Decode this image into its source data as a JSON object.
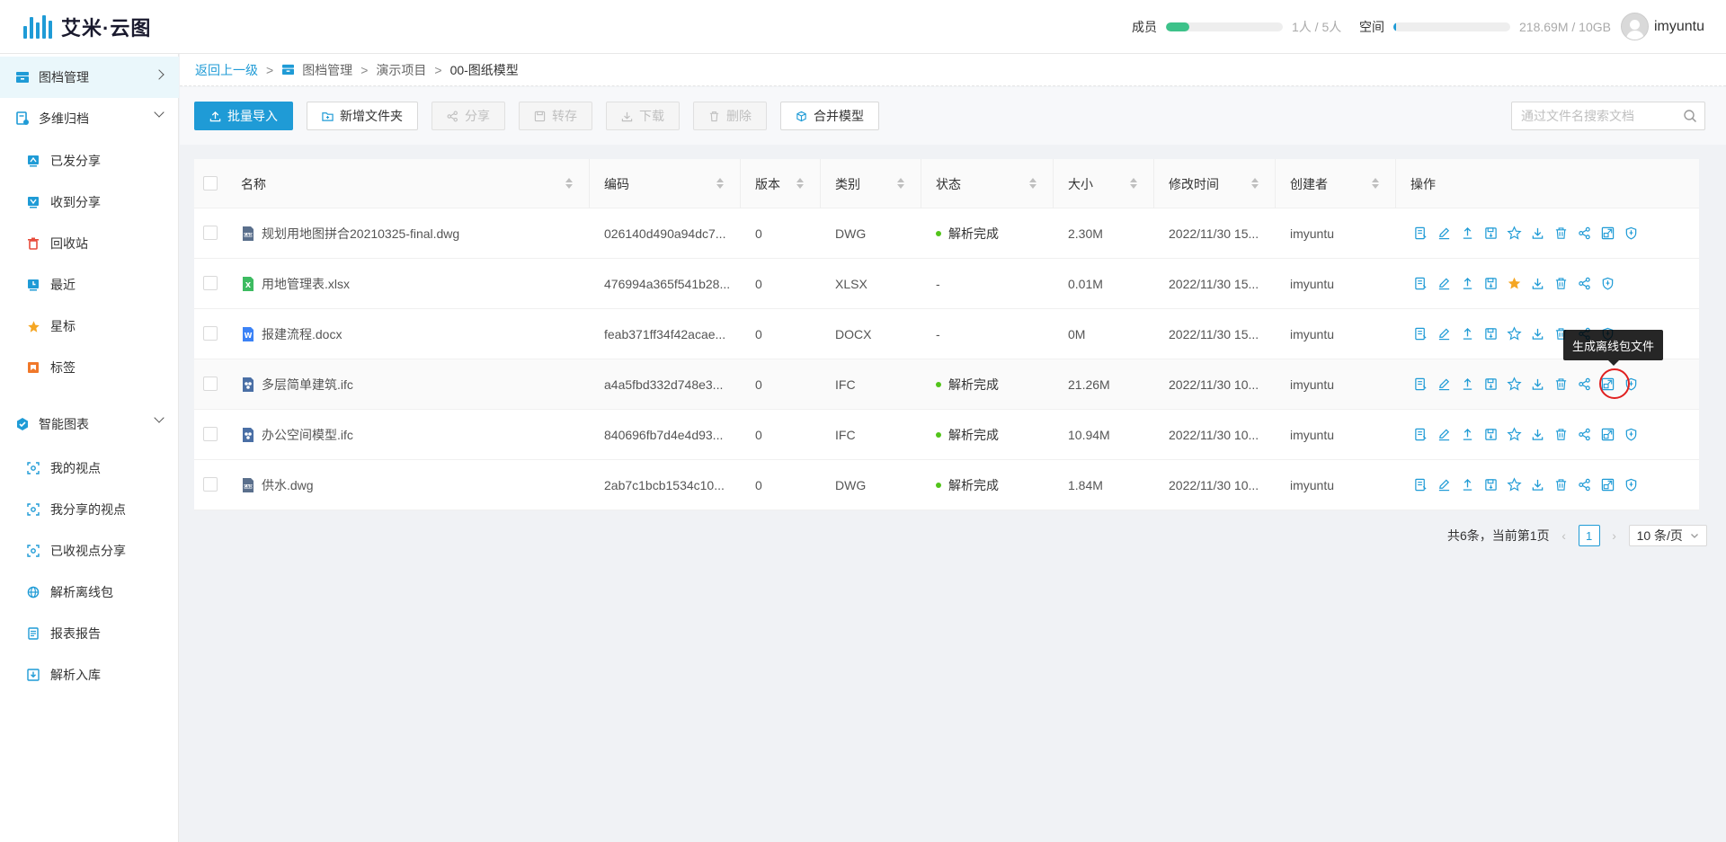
{
  "header": {
    "logo_text": "艾米·云图",
    "members": {
      "label": "成员",
      "value": "1人 / 5人",
      "fraction": 0.2,
      "color": "#3dc28a"
    },
    "space": {
      "label": "空间",
      "value": "218.69M / 10GB",
      "fraction": 0.02,
      "color": "#1f9bd6"
    },
    "user": "imyuntu"
  },
  "sidebar": {
    "groups": [
      {
        "label": "图档管理",
        "icon": "archive-icon"
      },
      {
        "label": "多维归档",
        "icon": "multi-archive-icon"
      },
      {
        "label": "智能图表",
        "icon": "smart-chart-icon"
      }
    ],
    "items_archive": [
      {
        "label": "已发分享",
        "icon": "sent-share-icon"
      },
      {
        "label": "收到分享",
        "icon": "received-share-icon"
      },
      {
        "label": "回收站",
        "icon": "trash-icon"
      },
      {
        "label": "最近",
        "icon": "recent-icon"
      },
      {
        "label": "星标",
        "icon": "star-icon"
      },
      {
        "label": "标签",
        "icon": "tag-icon"
      }
    ],
    "items_chart": [
      {
        "label": "我的视点",
        "icon": "viewpoint-icon"
      },
      {
        "label": "我分享的视点",
        "icon": "shared-viewpoint-icon"
      },
      {
        "label": "已收视点分享",
        "icon": "received-viewpoint-icon"
      },
      {
        "label": "解析离线包",
        "icon": "offline-package-icon"
      },
      {
        "label": "报表报告",
        "icon": "report-icon"
      },
      {
        "label": "解析入库",
        "icon": "import-icon"
      }
    ]
  },
  "breadcrumb": {
    "back": "返回上一级",
    "sep": ">",
    "items": [
      "图档管理",
      "演示项目",
      "00-图纸模型"
    ]
  },
  "toolbar": {
    "import": "批量导入",
    "new_folder": "新增文件夹",
    "share": "分享",
    "transfer": "转存",
    "download": "下载",
    "delete": "删除",
    "merge": "合并模型",
    "search_placeholder": "通过文件名搜索文档"
  },
  "table": {
    "headers": [
      "名称",
      "编码",
      "版本",
      "类别",
      "状态",
      "大小",
      "修改时间",
      "创建者",
      "操作"
    ],
    "rows": [
      {
        "name": "规划用地图拼合20210325-final.dwg",
        "ftype": "dwg",
        "code": "026140d490a94dc7...",
        "version": "0",
        "category": "DWG",
        "status": "解析完成",
        "size": "2.30M",
        "modified": "2022/11/30 15...",
        "creator": "imyuntu",
        "starred": false
      },
      {
        "name": "用地管理表.xlsx",
        "ftype": "xlsx",
        "code": "476994a365f541b28...",
        "version": "0",
        "category": "XLSX",
        "status": "-",
        "size": "0.01M",
        "modified": "2022/11/30 15...",
        "creator": "imyuntu",
        "starred": true
      },
      {
        "name": "报建流程.docx",
        "ftype": "docx",
        "code": "feab371ff34f42acae...",
        "version": "0",
        "category": "DOCX",
        "status": "-",
        "size": "0M",
        "modified": "2022/11/30 15...",
        "creator": "imyuntu",
        "starred": false
      },
      {
        "name": "多层简单建筑.ifc",
        "ftype": "ifc",
        "code": "a4a5fbd332d748e3...",
        "version": "0",
        "category": "IFC",
        "status": "解析完成",
        "size": "21.26M",
        "modified": "2022/11/30 10...",
        "creator": "imyuntu",
        "starred": false
      },
      {
        "name": "办公空间模型.ifc",
        "ftype": "ifc",
        "code": "840696fb7d4e4d93...",
        "version": "0",
        "category": "IFC",
        "status": "解析完成",
        "size": "10.94M",
        "modified": "2022/11/30 10...",
        "creator": "imyuntu",
        "starred": false
      },
      {
        "name": "供水.dwg",
        "ftype": "dwg",
        "code": "2ab7c1bcb1534c10...",
        "version": "0",
        "category": "DWG",
        "status": "解析完成",
        "size": "1.84M",
        "modified": "2022/11/30 10...",
        "creator": "imyuntu",
        "starred": false
      }
    ]
  },
  "tooltip": "生成离线包文件",
  "pagination": {
    "summary": "共6条，当前第1页",
    "page": "1",
    "page_size": "10 条/页"
  },
  "colors": {
    "accent": "#1f9bd6",
    "success": "#52c41a",
    "star": "#f5a623",
    "danger": "#e02020"
  }
}
